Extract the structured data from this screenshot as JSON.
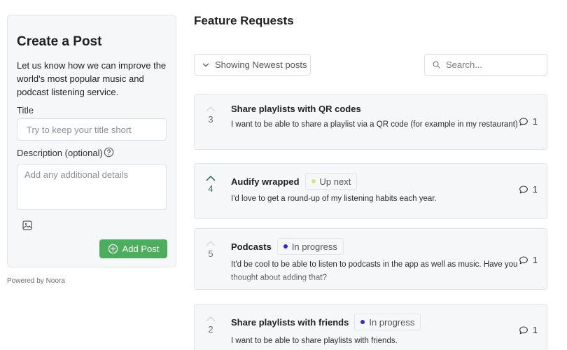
{
  "create_post": {
    "title": "Create a Post",
    "description": "Let us know how we can improve the world's most popular music and podcast listening service.",
    "title_label": "Title",
    "title_placeholder": "Try to keep your title short",
    "description_label": "Description (optional)",
    "description_placeholder": "Add any additional details",
    "add_button_label": "Add Post"
  },
  "powered_by": "Powered by Noora",
  "main": {
    "title": "Feature Requests",
    "sort_label": "Showing Newest posts",
    "search_placeholder": "Search..."
  },
  "posts": [
    {
      "title": "Share playlists with QR codes",
      "description": "I want to be able to share a playlist via a QR code (for example in my restaurant)",
      "votes": "3",
      "voted": false,
      "status": "",
      "comments": "1"
    },
    {
      "title": "Audify wrapped",
      "description": "I'd love to get a round-up of my listening habits each year.",
      "votes": "4",
      "voted": true,
      "status": "Up next",
      "status_color": "#d6e86a",
      "comments": "1"
    },
    {
      "title": "Podcasts",
      "description": "It'd be cool to be able to listen to podcasts in the app as well as music. Have you thought about adding that?",
      "votes": "5",
      "voted": false,
      "status": "In progress",
      "status_color": "#2b2bd4",
      "comments": "1"
    },
    {
      "title": "Share playlists with friends",
      "description": "I want to be able to share playlists with friends.",
      "votes": "2",
      "voted": false,
      "status": "In progress",
      "status_color": "#2b2bd4",
      "comments": "1"
    }
  ],
  "colors": {
    "accent_green": "#4cae5c",
    "voted_green": "#2f7d46",
    "panel_bg": "#f6f7f8"
  }
}
